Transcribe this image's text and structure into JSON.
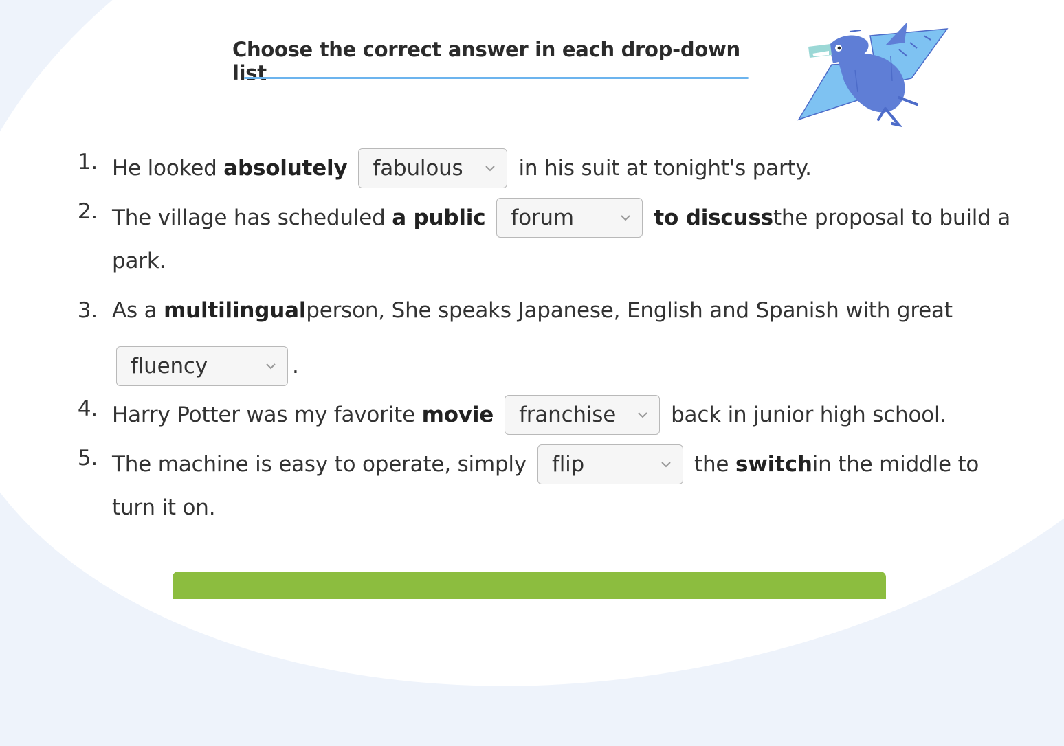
{
  "title": "Choose the correct answer in each drop-down list",
  "questions": [
    {
      "num": "1.",
      "parts": [
        "He looked ",
        "absolutely",
        " ",
        "fabulous",
        " in his suit at tonight's party."
      ]
    },
    {
      "num": "2.",
      "parts": [
        "The village has scheduled ",
        "a public",
        "forum",
        "to discuss",
        " the proposal to build a",
        "park."
      ]
    },
    {
      "num": "3.",
      "parts": [
        "As a ",
        "multilingual",
        " person, She speaks Japanese, English and Spanish with great",
        "fluency",
        "."
      ]
    },
    {
      "num": "4.",
      "parts": [
        "Harry Potter was my favorite ",
        "movie",
        "franchise",
        " back in junior high school."
      ]
    },
    {
      "num": "5.",
      "parts": [
        "The machine is easy to operate, simply ",
        "flip",
        " the ",
        "switch",
        " in the middle to",
        "turn it on."
      ]
    }
  ],
  "colors": {
    "accent_underline": "#6cb4ee",
    "submit_bar": "#8cbd3f",
    "dino_main": "#5f7ed6",
    "dino_wing": "#7ec2f2"
  },
  "icons": {
    "mascot": "pterodactyl-illustration",
    "dropdown": "chevron-down-icon"
  }
}
